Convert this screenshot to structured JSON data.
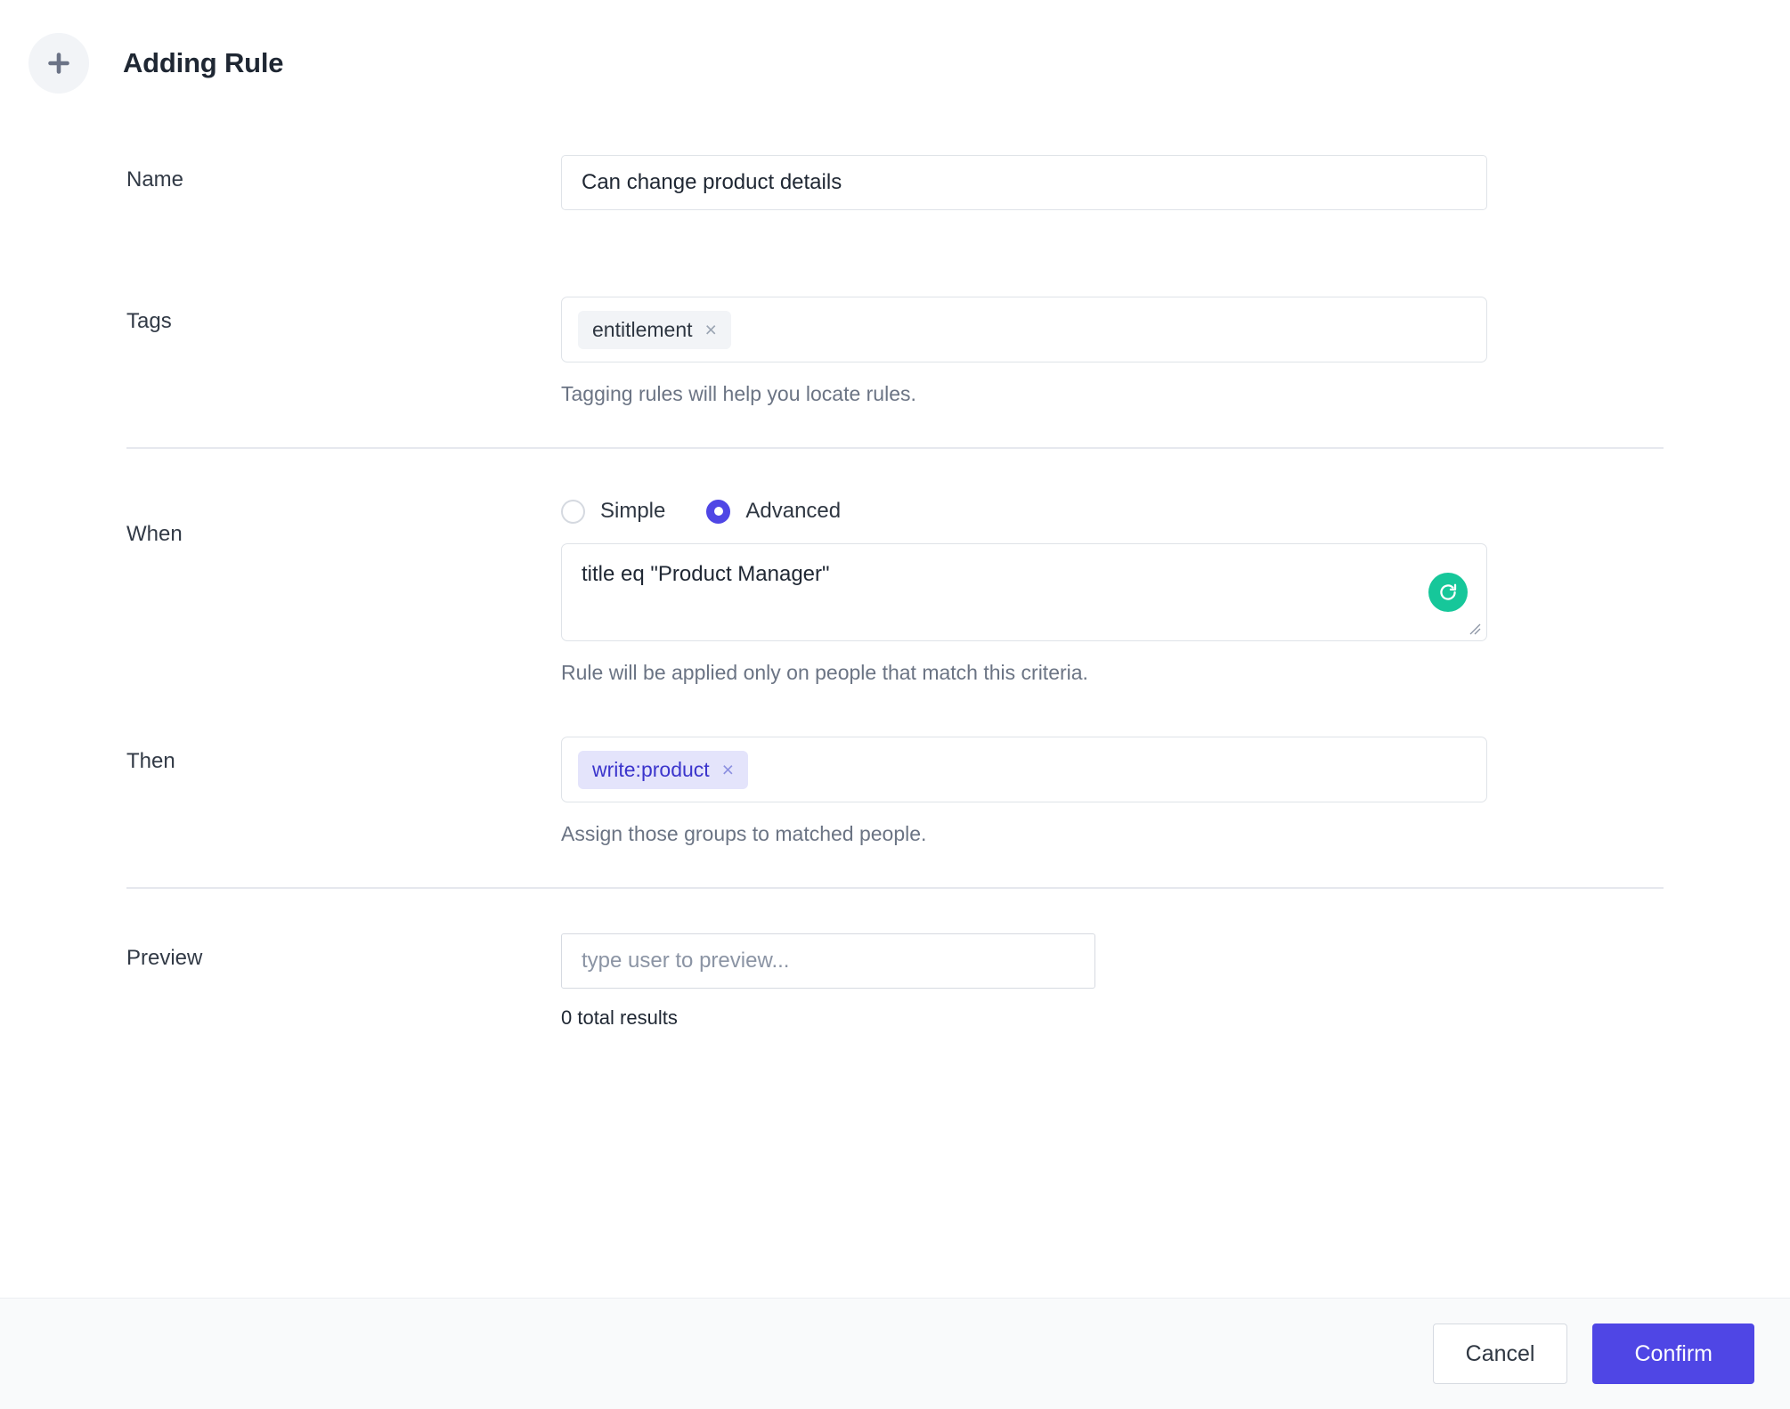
{
  "header": {
    "add_icon": "plus-icon",
    "title": "Adding Rule"
  },
  "form": {
    "name": {
      "label": "Name",
      "value": "Can change product details",
      "placeholder": ""
    },
    "tags": {
      "label": "Tags",
      "chips": [
        {
          "text": "entitlement",
          "remove": "×",
          "style": "gray"
        }
      ],
      "helper": "Tagging rules will help you locate rules."
    },
    "when": {
      "label": "When",
      "modes": [
        {
          "label": "Simple",
          "selected": false
        },
        {
          "label": "Advanced",
          "selected": true
        }
      ],
      "expression": "title eq \"Product Manager\"",
      "refresh_icon": "refresh-icon",
      "helper": "Rule will be applied only on people that match this criteria."
    },
    "then": {
      "label": "Then",
      "chips": [
        {
          "text": "write:product",
          "remove": "×",
          "style": "indigo"
        }
      ],
      "helper": "Assign those groups to matched people."
    },
    "preview": {
      "label": "Preview",
      "placeholder": "type user to preview...",
      "value": "",
      "results": "0 total results"
    }
  },
  "footer": {
    "cancel_label": "Cancel",
    "confirm_label": "Confirm"
  },
  "colors": {
    "accent": "#4f46e5",
    "refresh": "#16c79a",
    "chip_gray_bg": "#f2f4f7",
    "chip_indigo_bg": "#e4e4fb",
    "chip_indigo_text": "#3b35cc",
    "footer_bg": "#f9fafb",
    "border": "#dfe3e8",
    "helper_text": "#6b7484"
  }
}
